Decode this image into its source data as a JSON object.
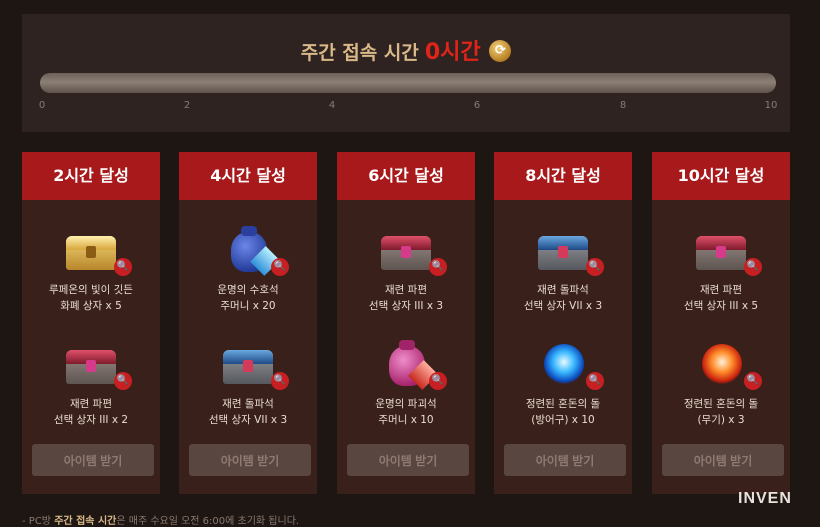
{
  "header": {
    "title": "주간 접속 시간",
    "hours": "0시간",
    "refresh_icon": "refresh-icon",
    "progress": 0,
    "tick_labels": [
      "0",
      "2",
      "4",
      "6",
      "8",
      "10"
    ]
  },
  "cards": [
    {
      "title": "2시간 달성",
      "rewards": [
        {
          "icon": "gold-chest-icon",
          "line1": "루페온의 빛이 깃든",
          "line2": "화폐 상자 x 5"
        },
        {
          "icon": "red-chest-icon",
          "line1": "재련 파편",
          "line2": "선택 상자 III x 2"
        }
      ],
      "button": "아이템 받기"
    },
    {
      "title": "4시간 달성",
      "rewards": [
        {
          "icon": "blue-pouch-icon",
          "line1": "운명의 수호석",
          "line2": "주머니 x 20"
        },
        {
          "icon": "blue-chest-icon",
          "line1": "재련 돌파석",
          "line2": "선택 상자 VII x 3"
        }
      ],
      "button": "아이템 받기"
    },
    {
      "title": "6시간 달성",
      "rewards": [
        {
          "icon": "red-chest-icon",
          "line1": "재련 파편",
          "line2": "선택 상자 III x 3"
        },
        {
          "icon": "pink-pouch-icon",
          "line1": "운명의 파괴석",
          "line2": "주머니 x 10"
        }
      ],
      "button": "아이템 받기"
    },
    {
      "title": "8시간 달성",
      "rewards": [
        {
          "icon": "blue-chest-icon",
          "line1": "재련 돌파석",
          "line2": "선택 상자 VII x 3"
        },
        {
          "icon": "blue-chaos-stone-icon",
          "line1": "정련된 혼돈의 돌",
          "line2": "(방어구) x 10"
        }
      ],
      "button": "아이템 받기"
    },
    {
      "title": "10시간 달성",
      "rewards": [
        {
          "icon": "red-chest-icon",
          "line1": "재련 파편",
          "line2": "선택 상자 III x 5"
        },
        {
          "icon": "red-chaos-stone-icon",
          "line1": "정련된 혼돈의 돌",
          "line2": "(무기) x 3"
        }
      ],
      "button": "아이템 받기"
    }
  ],
  "footnote": {
    "prefix": "- PC방 ",
    "bold": "주간 접속 시간",
    "suffix": "은 매주 수요일 오전 6:00에 초기화 됩니다."
  },
  "watermark": "INVEN",
  "zoom_icon": "magnifier-icon",
  "colors": {
    "header_red": "#a8191b",
    "hours_red": "#e0241a",
    "title_gold": "#d9b98a",
    "card_bg": "#3a201a",
    "button_bg": "#5a4640"
  }
}
